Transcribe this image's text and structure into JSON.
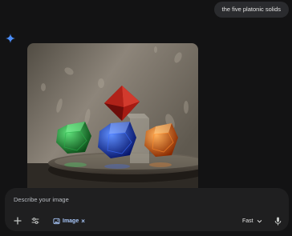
{
  "chat": {
    "user_message": "the five platonic solids"
  },
  "composer": {
    "placeholder": "Describe your image",
    "image_chip_label": "Image",
    "model_label": "Fast"
  },
  "icons": {
    "assistant": "sparkle-icon",
    "add": "plus-icon",
    "tools": "tune-icon",
    "image_chip": "image-gen-icon",
    "chip_remove": "close-icon",
    "model_menu": "chevron-down-icon",
    "voice": "mic-icon"
  },
  "colors": {
    "background": "#131314",
    "bubble": "#2a2b2e",
    "composer": "#1f1f20",
    "accent": "#a8c7fa",
    "sparkle": "#4b8df8"
  }
}
